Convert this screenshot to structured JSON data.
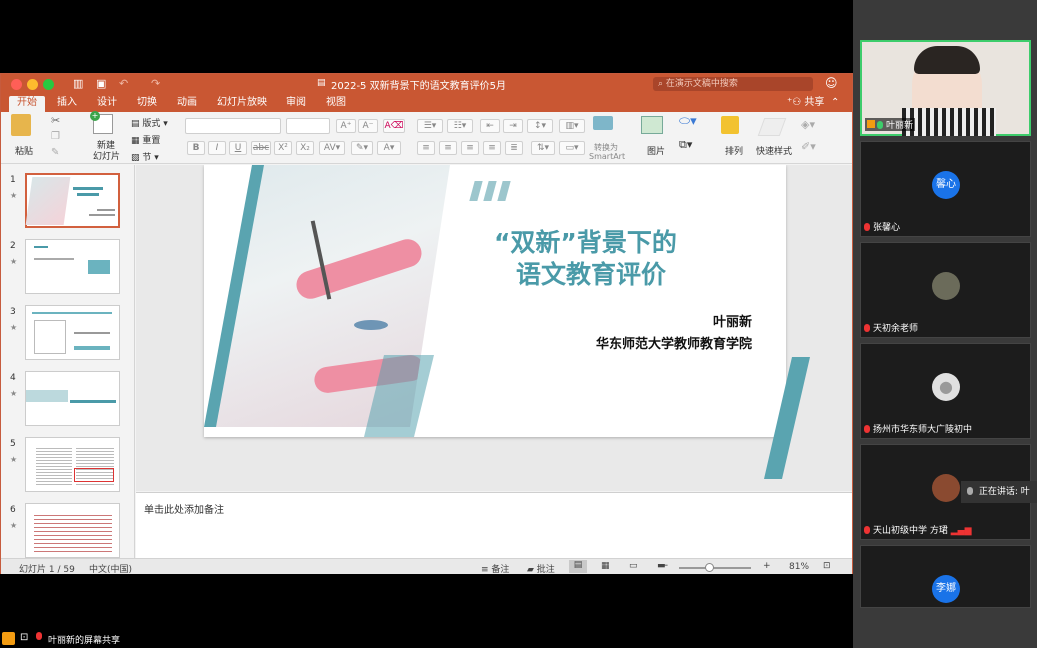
{
  "window": {
    "title": "2022-5 双新背景下的语文教育评价5月",
    "search_placeholder": "在演示文稿中搜索"
  },
  "tabs": [
    "开始",
    "插入",
    "设计",
    "切换",
    "动画",
    "幻灯片放映",
    "审阅",
    "视图"
  ],
  "share_label": "共享",
  "ribbon": {
    "paste": "粘贴",
    "new_slide_line1": "新建",
    "new_slide_line2": "幻灯片",
    "layout": "版式",
    "reset": "重置",
    "section": "节",
    "convert_line1": "转换为",
    "convert_line2": "SmartArt",
    "picture": "图片",
    "arrange": "排列",
    "quick_styles": "快速样式"
  },
  "slide_numbers": [
    "1",
    "2",
    "3",
    "4",
    "5",
    "6"
  ],
  "slide": {
    "title_line1": "“双新”背景下的",
    "title_line2": "语文教育评价",
    "author": "叶丽新",
    "institution": "华东师范大学教师教育学院"
  },
  "notes_placeholder": "单击此处添加备注",
  "status": {
    "slide_counter": "幻灯片 1 / 59",
    "language": "中文(中国)",
    "notes": "备注",
    "comments": "批注",
    "zoom": "81%"
  },
  "participants": [
    {
      "name": "叶丽新",
      "avatar": "",
      "color": "#d9d9d9"
    },
    {
      "name": "张馨心",
      "avatar": "馨心",
      "color": "#1a73e8"
    },
    {
      "name": "天初余老师",
      "avatar": "",
      "color": "#6b6b5a"
    },
    {
      "name": "扬州市华东师大广陵初中",
      "avatar": "",
      "color": "#e0e0e0"
    },
    {
      "name": "天山初级中学 方珺",
      "avatar": "",
      "color": "#8a4a30"
    },
    {
      "name": "李娜",
      "avatar": "李娜",
      "color": "#1a73e8"
    }
  ],
  "speaking_label": "正在讲话: 叶",
  "bottom_bar": {
    "share_label": "叶丽新的屏幕共享"
  }
}
